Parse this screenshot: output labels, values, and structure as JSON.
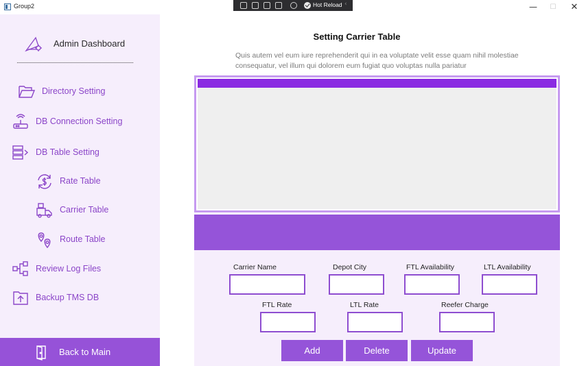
{
  "window": {
    "title": "Group2",
    "minimize_glyph": "—",
    "maximize_glyph": "☐",
    "close_glyph": "✕"
  },
  "debug_toolbar": {
    "hot_reload_label": "Hot Reload",
    "chevron": "‹"
  },
  "sidebar": {
    "title": "Admin Dashboard",
    "title_icon": "compass-ruler-icon",
    "items": [
      {
        "label": "Directory Setting",
        "icon": "folder-icon"
      },
      {
        "label": "DB Connection Setting",
        "icon": "router-icon"
      },
      {
        "label": "DB Table Setting",
        "icon": "table-list-icon"
      },
      {
        "label": "Rate Table",
        "icon": "dollar-refresh-icon"
      },
      {
        "label": "Carrier Table",
        "icon": "truck-icon"
      },
      {
        "label": "Route Table",
        "icon": "map-pin-icon"
      },
      {
        "label": "Review Log Files",
        "icon": "flowchart-icon"
      },
      {
        "label": "Backup TMS DB",
        "icon": "upload-folder-icon"
      }
    ],
    "back_button": {
      "label": "Back to Main",
      "icon": "door-exit-icon"
    }
  },
  "main": {
    "title": "Setting Carrier Table",
    "description": "Quis autem vel eum iure reprehenderit qui in ea voluptate velit esse quam nihil molestiae consequatur, vel illum qui dolorem eum fugiat quo voluptas nulla pariatur"
  },
  "form": {
    "carrier_name": {
      "label": "Carrier Name",
      "value": ""
    },
    "depot_city": {
      "label": "Depot City",
      "value": ""
    },
    "ftl_availability": {
      "label": "FTL Availability",
      "value": ""
    },
    "ltl_availability": {
      "label": "LTL Availability",
      "value": ""
    },
    "ftl_rate": {
      "label": "FTL Rate",
      "value": ""
    },
    "ltl_rate": {
      "label": "LTL Rate",
      "value": ""
    },
    "reefer_charge": {
      "label": "Reefer Charge",
      "value": ""
    },
    "buttons": {
      "add": "Add",
      "delete": "Delete",
      "update": "Update"
    }
  },
  "colors": {
    "accent": "#9554d9",
    "grid_header": "#8a2be2",
    "sidebar_bg": "#f6eefc",
    "nav_text": "#8b45c8"
  }
}
